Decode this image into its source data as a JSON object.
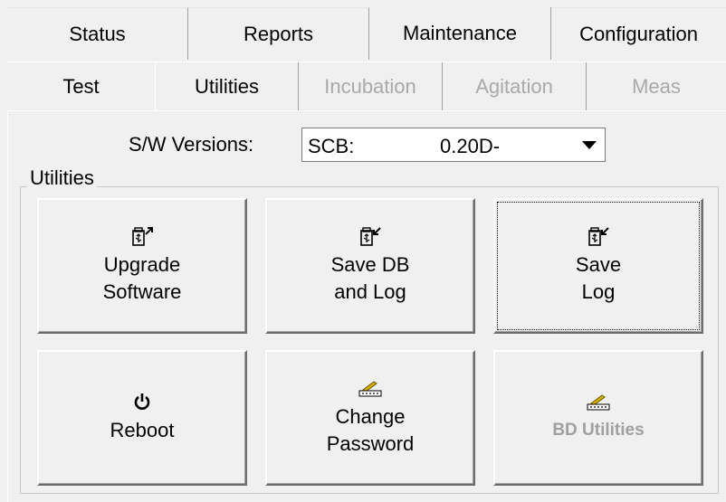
{
  "tabs_top": [
    {
      "label": "Status"
    },
    {
      "label": "Reports"
    },
    {
      "label": "Maintenance"
    },
    {
      "label": "Configuration"
    }
  ],
  "tabs_sub": [
    {
      "label": "Test",
      "enabled": true
    },
    {
      "label": "Utilities",
      "enabled": true,
      "selected": true
    },
    {
      "label": "Incubation",
      "enabled": false
    },
    {
      "label": "Agitation",
      "enabled": false
    },
    {
      "label": "Meas",
      "enabled": false
    }
  ],
  "sw_versions": {
    "label": "S/W Versions:",
    "selected_key": "SCB:",
    "selected_value": "0.20D-"
  },
  "utilities_group": {
    "title": "Utilities",
    "buttons": [
      {
        "line1": "Upgrade",
        "line2": "Software",
        "icon": "usb-upload-icon"
      },
      {
        "line1": "Save DB",
        "line2": "and Log",
        "icon": "usb-download-icon"
      },
      {
        "line1": "Save",
        "line2": "Log",
        "icon": "usb-download-icon",
        "focused": true
      },
      {
        "line1": "Reboot",
        "icon": "power-icon"
      },
      {
        "line1": "Change",
        "line2": "Password",
        "icon": "key-pencil-icon"
      },
      {
        "line1": "BD Utilities",
        "icon": "key-pencil-icon",
        "enabled": false
      }
    ]
  }
}
